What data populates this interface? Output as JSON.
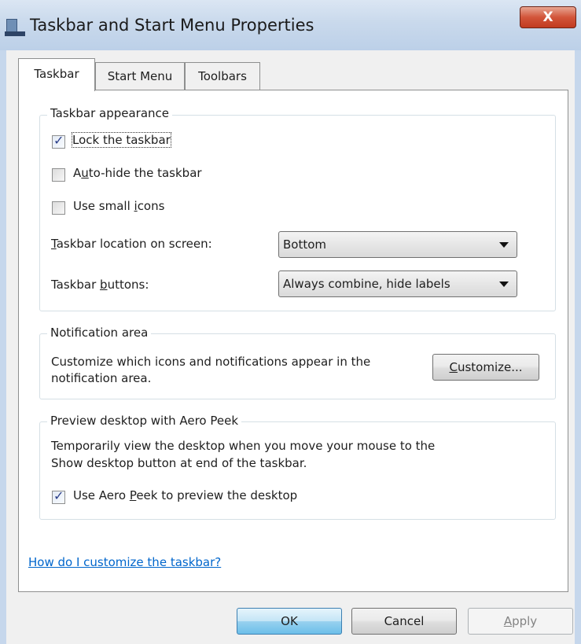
{
  "window": {
    "title": "Taskbar and Start Menu Properties",
    "close_label": "X"
  },
  "tabs": [
    {
      "label": "Taskbar",
      "active": true
    },
    {
      "label": "Start Menu",
      "active": false
    },
    {
      "label": "Toolbars",
      "active": false
    }
  ],
  "taskbar_appearance": {
    "heading": "Taskbar appearance",
    "lock_taskbar": {
      "label": "Lock the taskbar",
      "checked": true
    },
    "auto_hide": {
      "label_pre": "A",
      "label_u": "u",
      "label_post": "to-hide the taskbar",
      "checked": false
    },
    "small_icons": {
      "label_pre": "Use small ",
      "label_u": "i",
      "label_post": "cons",
      "checked": false
    },
    "location": {
      "label_u": "T",
      "label_post": "askbar location on screen:",
      "value": "Bottom"
    },
    "buttons": {
      "label_pre": "Taskbar ",
      "label_u": "b",
      "label_post": "uttons:",
      "value": "Always combine, hide labels"
    }
  },
  "notification_area": {
    "heading": "Notification area",
    "description_line1": "Customize which icons and notifications appear in the",
    "description_line2": "notification area.",
    "customize_u": "C",
    "customize_rest": "ustomize..."
  },
  "aero_peek": {
    "heading": "Preview desktop with Aero Peek",
    "description_line1": "Temporarily view the desktop when you move your mouse to the",
    "description_line2": "Show desktop button at end of the taskbar.",
    "checkbox": {
      "label_pre": "Use Aero ",
      "label_u": "P",
      "label_post": "eek to preview the desktop",
      "checked": true
    }
  },
  "help_link": "How do I customize the taskbar?",
  "footer": {
    "ok": "OK",
    "cancel": "Cancel",
    "apply_u": "A",
    "apply_rest": "pply"
  },
  "icons": {
    "check_mark": "✓"
  }
}
